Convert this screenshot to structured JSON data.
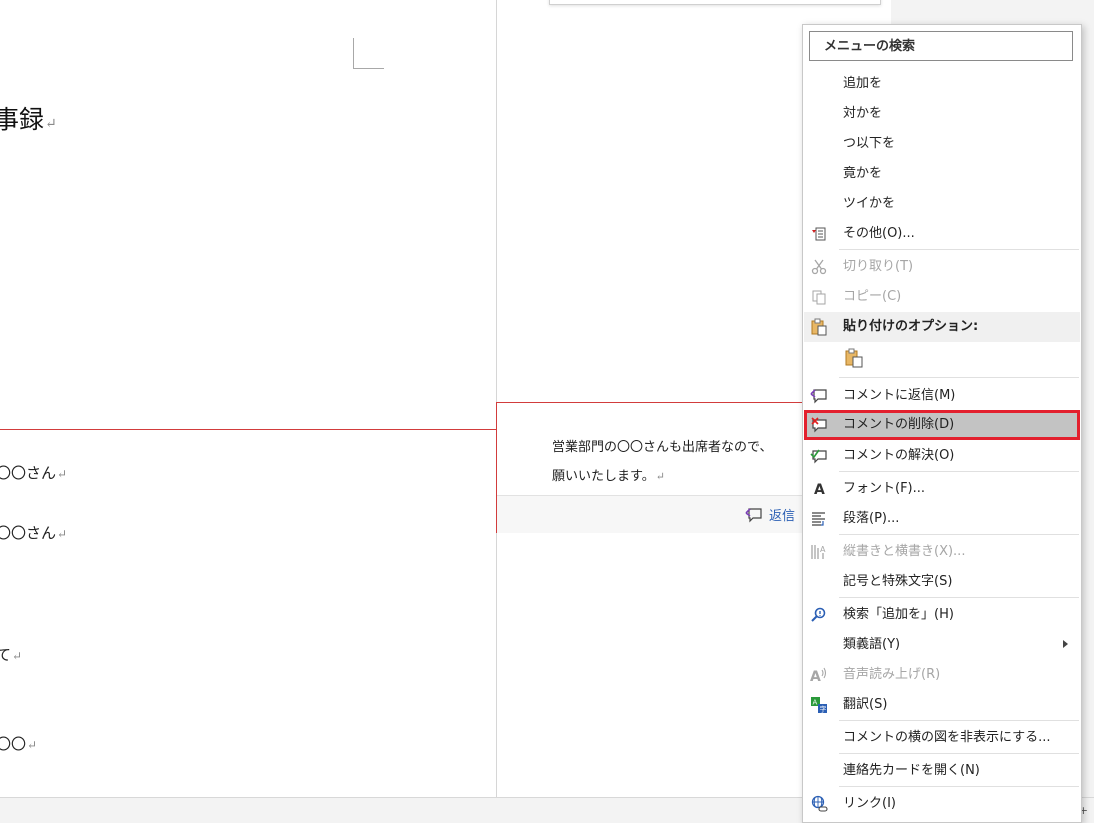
{
  "document": {
    "title": "事録",
    "paragraph_mark": "↵",
    "lines": [
      "〇〇さん",
      "〇〇さん",
      "て",
      "〇〇"
    ]
  },
  "comment": {
    "lines": [
      "営業部門の〇〇さんも出席者なので、",
      "願いいたします。"
    ],
    "reply_label": "返信"
  },
  "status_bar": {
    "zoom_hint": "- +"
  },
  "context_menu": {
    "search_placeholder": "メニューの検索",
    "items": [
      {
        "label": "追加を"
      },
      {
        "label": "対かを"
      },
      {
        "label": "つ以下を"
      },
      {
        "label": "竟かを"
      },
      {
        "label": "ツイかを"
      },
      {
        "label": "その他(O)...",
        "icon": "more-options-icon"
      },
      {
        "label": "切り取り(T)",
        "icon": "scissors-icon",
        "disabled": true
      },
      {
        "label": "コピー(C)",
        "icon": "copy-icon",
        "disabled": true
      },
      {
        "label": "貼り付けのオプション:",
        "icon": "paste-icon"
      },
      {
        "label": "",
        "icon": "paste-keep-text-icon"
      },
      {
        "label": "コメントに返信(M)",
        "icon": "comment-reply-icon"
      },
      {
        "label": "コメントの削除(D)",
        "icon": "comment-delete-icon",
        "highlighted": true
      },
      {
        "label": "コメントの解決(O)",
        "icon": "comment-resolve-icon"
      },
      {
        "label": "フォント(F)...",
        "icon": "font-icon"
      },
      {
        "label": "段落(P)...",
        "icon": "paragraph-icon"
      },
      {
        "label": "縦書きと横書き(X)...",
        "icon": "text-direction-icon",
        "disabled": true
      },
      {
        "label": "記号と特殊文字(S)"
      },
      {
        "label": "検索「追加を」(H)",
        "icon": "smart-lookup-icon"
      },
      {
        "label": "類義語(Y)",
        "submenu": true
      },
      {
        "label": "音声読み上げ(R)",
        "icon": "read-aloud-icon",
        "disabled": true
      },
      {
        "label": "翻訳(S)",
        "icon": "translate-icon"
      },
      {
        "label": "コメントの横の図を非表示にする..."
      },
      {
        "label": "連絡先カードを開く(N)"
      },
      {
        "label": "リンク(I)",
        "icon": "link-icon"
      }
    ]
  },
  "colors": {
    "highlight_outline": "#e3202e",
    "highlight_fill": "#c3c3c3",
    "comment_border": "#d23c3c",
    "reply_text": "#2b5fb4"
  }
}
